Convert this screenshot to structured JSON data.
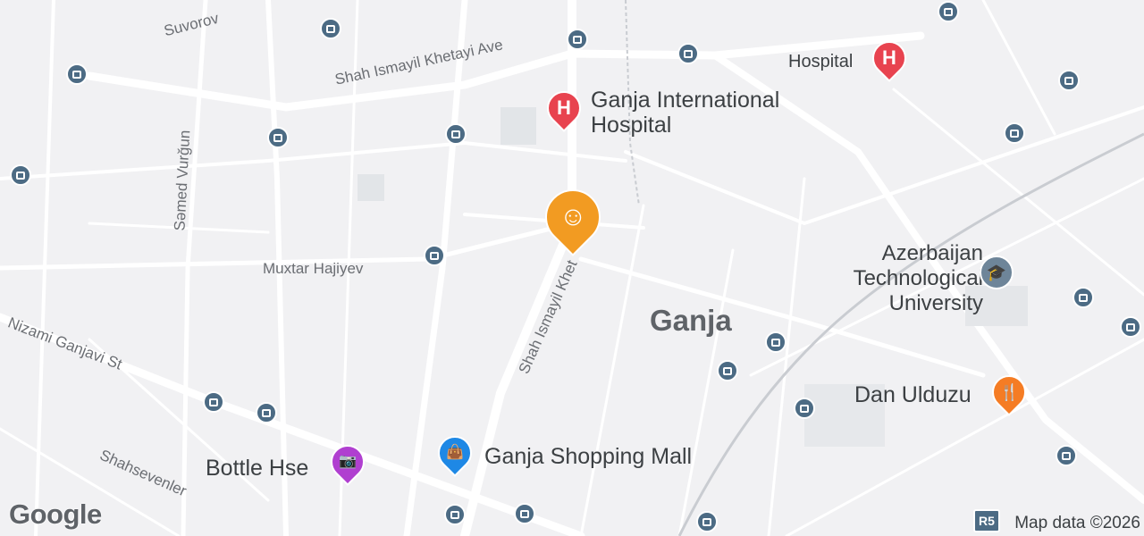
{
  "city": "Ganja",
  "streets": {
    "suvorov": "Suvorov",
    "shah_ismayil_ave": "Shah Ismayil Khetayi Ave",
    "samed_vurgun": "Səmed Vurğun",
    "muxtar": "Muxtar Hajiyev",
    "nizami": "Nizami Ganjavi St",
    "shah_ismayil_khet": "Shah Ismayil Khet",
    "shahsevenler": "Shahsevenler"
  },
  "pois": {
    "hospital_small": "Hospital",
    "ganja_hospital": "Ganja International Hospital",
    "atu": "Azerbaijan Technological University",
    "dan_ulduzu": "Dan Ulduzu",
    "mall": "Ganja Shopping Mall",
    "bottle": "Bottle Hse"
  },
  "icons": {
    "hospital": "hospital-icon",
    "university": "university-icon",
    "restaurant": "restaurant-icon",
    "shopping": "shopping-bag-icon",
    "camera": "camera-icon",
    "bus": "bus-stop-icon",
    "smiley": "current-location-smiley-icon"
  },
  "colors": {
    "hospital": "#e8434f",
    "university": "#6e8599",
    "restaurant": "#f57c24",
    "shopping": "#1e88e5",
    "camera": "#b03fd0",
    "bus": "#4c6b84",
    "smiley": "#f29b22"
  },
  "route_shield": "R5",
  "attribution": "Map data ©2026",
  "logo": "Google"
}
